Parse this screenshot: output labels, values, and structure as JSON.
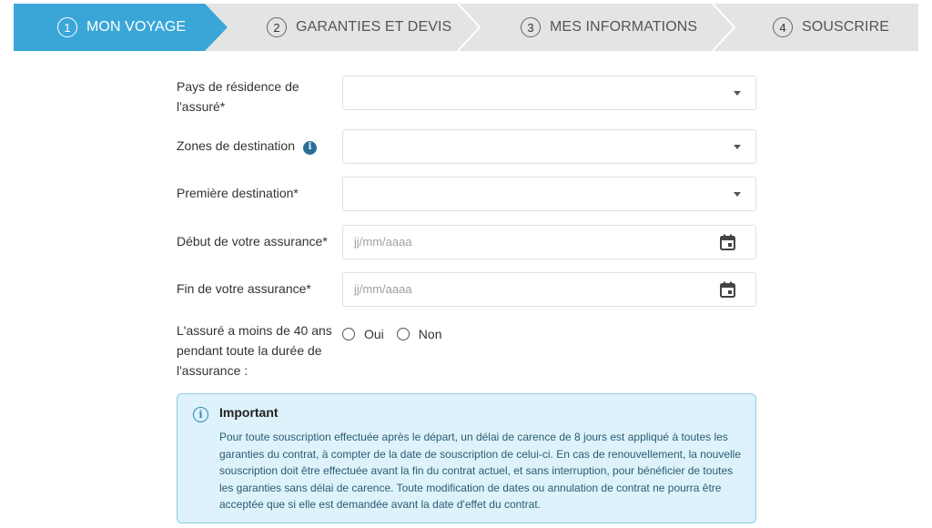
{
  "stepper": {
    "steps": [
      {
        "number": "1",
        "label": "MON VOYAGE",
        "active": true
      },
      {
        "number": "2",
        "label": "GARANTIES ET DEVIS",
        "active": false
      },
      {
        "number": "3",
        "label": "MES INFORMATIONS",
        "active": false
      },
      {
        "number": "4",
        "label": "SOUSCRIRE",
        "active": false
      }
    ],
    "active_color": "#3aa6d8",
    "inactive_color": "#e4e4e4"
  },
  "form": {
    "residence": {
      "label": "Pays de résidence de l'assuré*",
      "value": ""
    },
    "zones": {
      "label": "Zones de destination",
      "value": ""
    },
    "first_destination": {
      "label": "Première destination*",
      "value": ""
    },
    "start_date": {
      "label": "Début de votre assurance*",
      "placeholder": "jj/mm/aaaa"
    },
    "end_date": {
      "label": "Fin de votre assurance*",
      "placeholder": "jj/mm/aaaa"
    },
    "under_40": {
      "label": "L'assuré a moins de 40 ans pendant toute la durée de l'assurance :",
      "options": [
        "Oui",
        "Non"
      ]
    }
  },
  "notice": {
    "title": "Important",
    "body": "Pour toute souscription effectuée après le départ, un délai de carence de 8 jours est appliqué à toutes les garanties du contrat, à compter de la date de souscription de celui-ci. En cas de renouvellement, la nouvelle souscription doit être effectuée avant la fin du contrat actuel, et sans interruption, pour bénéficier de toutes les garanties sans délai de carence. Toute modification de dates ou annulation de contrat ne pourra être acceptée que si elle est demandée avant la date d'effet du contrat."
  }
}
